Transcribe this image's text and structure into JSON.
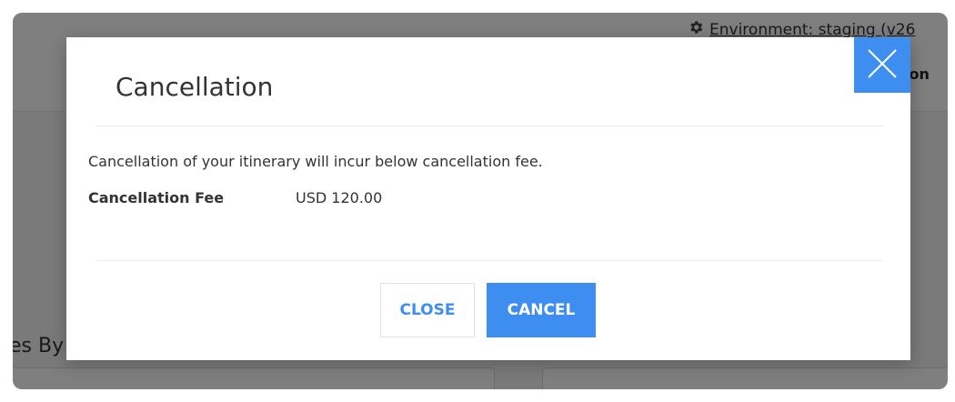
{
  "background": {
    "environment_label": "Environment: staging (v26",
    "nav_fragment": "ion",
    "section_fragment": "es By",
    "gear_icon": "gear-icon"
  },
  "modal": {
    "title": "Cancellation",
    "message": "Cancellation of your itinerary will incur below cancellation fee.",
    "fee_label": "Cancellation Fee",
    "fee_value": "USD 120.00",
    "close_label": "CLOSE",
    "cancel_label": "CANCEL",
    "close_icon": "close-icon"
  },
  "colors": {
    "accent": "#3d8ef0",
    "overlay": "rgba(0,0,0,0.5)",
    "text": "#333333"
  }
}
